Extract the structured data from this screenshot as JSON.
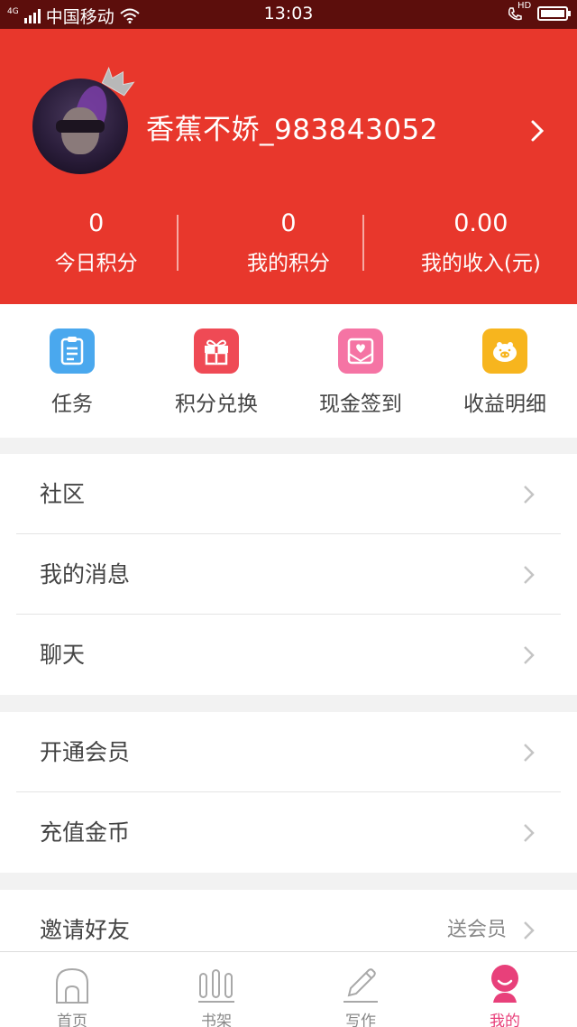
{
  "status_bar": {
    "network": "4G",
    "carrier": "中国移动",
    "time": "13:03",
    "hd_label": "HD"
  },
  "profile": {
    "username": "香蕉不娇_983843052"
  },
  "stats": [
    {
      "value": "0",
      "label": "今日积分"
    },
    {
      "value": "0",
      "label": "我的积分"
    },
    {
      "value": "0.00",
      "label": "我的收入(元)"
    }
  ],
  "quick_actions": [
    {
      "label": "任务",
      "icon": "task-icon",
      "color": "#4aa8ee"
    },
    {
      "label": "积分兑换",
      "icon": "gift-icon",
      "color": "#ef4a55"
    },
    {
      "label": "现金签到",
      "icon": "envelope-heart-icon",
      "color": "#f574a4"
    },
    {
      "label": "收益明细",
      "icon": "piggy-bank-icon",
      "color": "#f7b51e"
    }
  ],
  "menu_groups": [
    {
      "rows": [
        {
          "label": "社区"
        },
        {
          "label": "我的消息"
        },
        {
          "label": "聊天"
        }
      ]
    },
    {
      "rows": [
        {
          "label": "开通会员"
        },
        {
          "label": "充值金币"
        }
      ]
    },
    {
      "rows": [
        {
          "label": "邀请好友",
          "extra": "送会员"
        }
      ]
    }
  ],
  "tabbar": [
    {
      "label": "首页",
      "icon": "home-icon",
      "active": false
    },
    {
      "label": "书架",
      "icon": "bookshelf-icon",
      "active": false
    },
    {
      "label": "写作",
      "icon": "pen-icon",
      "active": false
    },
    {
      "label": "我的",
      "icon": "profile-icon",
      "active": true
    }
  ],
  "colors": {
    "header_red": "#e8372c",
    "status_bar": "#5c0e0c",
    "active_tab": "#e8407a"
  }
}
